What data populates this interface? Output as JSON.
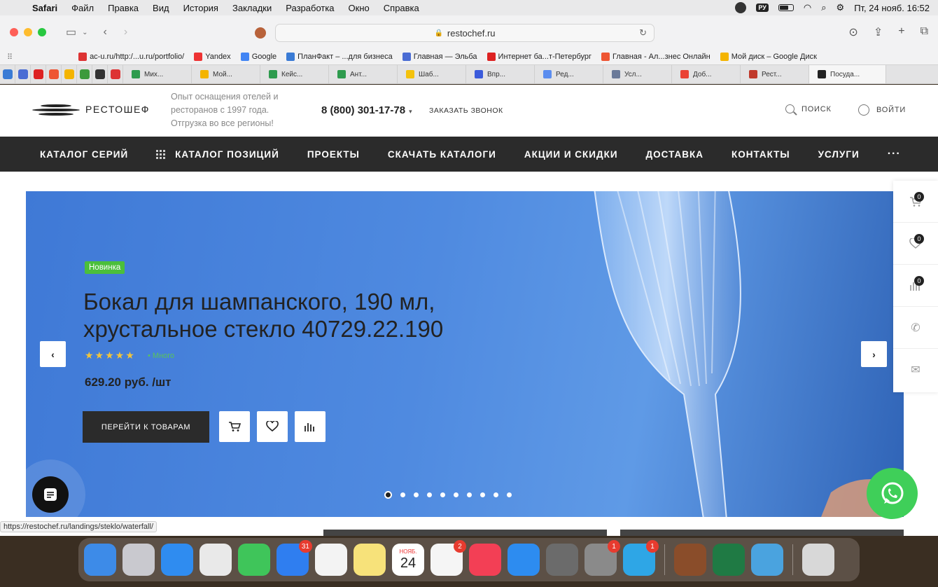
{
  "menubar": {
    "app": "Safari",
    "items": [
      "Файл",
      "Правка",
      "Вид",
      "История",
      "Закладки",
      "Разработка",
      "Окно",
      "Справка"
    ],
    "input_source": "РУ",
    "datetime": "Пт, 24 нояб.  16:52"
  },
  "browser": {
    "url": "restochef.ru",
    "status_url": "https://restochef.ru/landings/steklo/waterfall/",
    "bookmarks": [
      {
        "label": "ac-u.ru/http:/...u.ru/portfolio/",
        "color": "#d33"
      },
      {
        "label": "Yandex",
        "color": "#e33"
      },
      {
        "label": "Google",
        "color": "#4285f4"
      },
      {
        "label": "ПланФакт – ...для бизнеса",
        "color": "#3a7bd5"
      },
      {
        "label": "Главная — Эльба",
        "color": "#4a6cd4"
      },
      {
        "label": "Интернет ба...т-Петербург",
        "color": "#d22"
      },
      {
        "label": "Главная - Ал...знес Онлайн",
        "color": "#e53"
      },
      {
        "label": "Мой диск – Google Диск",
        "color": "#f4b400"
      }
    ],
    "pinned_tabs": [
      {
        "name": "pf",
        "color": "#3a7bd5"
      },
      {
        "name": "elba",
        "color": "#4a6cd4"
      },
      {
        "name": "bank",
        "color": "#d22"
      },
      {
        "name": "alfa",
        "color": "#e53"
      },
      {
        "name": "drive",
        "color": "#f4b400"
      },
      {
        "name": "green",
        "color": "#3c9a3c"
      },
      {
        "name": "g-black",
        "color": "#333"
      },
      {
        "name": "red-app",
        "color": "#d33"
      }
    ],
    "tabs": [
      {
        "label": "Мих...",
        "color": "#2e9b4e"
      },
      {
        "label": "Мой...",
        "color": "#f4b400"
      },
      {
        "label": "Кейс...",
        "color": "#2e9b4e"
      },
      {
        "label": "Ант...",
        "color": "#2e9b4e"
      },
      {
        "label": "Шаб...",
        "color": "#f4c20d"
      },
      {
        "label": "Впр...",
        "color": "#3b5bdb"
      },
      {
        "label": "Ред...",
        "color": "#5b8def"
      },
      {
        "label": "Усл...",
        "color": "#6b7a99"
      },
      {
        "label": "Доб...",
        "color": "#ea4335"
      },
      {
        "label": "Рест...",
        "color": "#c0392b"
      },
      {
        "label": "Посуда...",
        "color": "#222"
      }
    ]
  },
  "site": {
    "logo_text": "РЕСТОШЕФ",
    "tagline": "Опыт оснащения отелей и ресторанов с 1997 года. Отгрузка во все регионы!",
    "phone": "8 (800) 301-17-78",
    "callback": "ЗАКАЗАТЬ ЗВОНОК",
    "search": "ПОИСК",
    "login": "ВОЙТИ",
    "nav": [
      "КАТАЛОГ СЕРИЙ",
      "КАТАЛОГ ПОЗИЦИЙ",
      "ПРОЕКТЫ",
      "СКАЧАТЬ КАТАЛОГИ",
      "АКЦИИ И СКИДКИ",
      "ДОСТАВКА",
      "КОНТАКТЫ",
      "УСЛУГИ"
    ],
    "nav_more": "···",
    "banner": {
      "badge": "Новинка",
      "title": "Бокал для шампанского, 190 мл, хрустальное стекло 40729.22.190",
      "rating": 5,
      "stars": "★★★★★",
      "stock": "• Много",
      "price": "629.20 руб. /шт",
      "cta": "ПЕРЕЙТИ К ТОВАРАМ",
      "slides_total": 10,
      "active_slide": 1
    },
    "side_panel": {
      "cart_count": "0",
      "favorites_count": "0",
      "compare_count": "0"
    }
  },
  "dock": [
    {
      "name": "finder",
      "color": "#3d8be8"
    },
    {
      "name": "launchpad",
      "color": "#c9c9cf"
    },
    {
      "name": "safari",
      "color": "#2f8cf0"
    },
    {
      "name": "chrome",
      "color": "#e9e9e9"
    },
    {
      "name": "messages",
      "color": "#3fc55a"
    },
    {
      "name": "mail",
      "color": "#2f7ef0",
      "badge": "31"
    },
    {
      "name": "photos",
      "color": "#f3f3f3"
    },
    {
      "name": "notes",
      "color": "#f7e27a"
    },
    {
      "name": "calendar",
      "color": "#ffffff",
      "month": "НОЯБ.",
      "day": "24"
    },
    {
      "name": "reminders",
      "color": "#f5f5f5",
      "badge": "2"
    },
    {
      "name": "music",
      "color": "#f33f55"
    },
    {
      "name": "app-store",
      "color": "#2d8cf0"
    },
    {
      "name": "calculator",
      "color": "#6b6b6b"
    },
    {
      "name": "system-settings",
      "color": "#8a8a8a",
      "badge": "1"
    },
    {
      "name": "telegram",
      "color": "#2ea6e6",
      "badge": "1"
    },
    {
      "name": "sep"
    },
    {
      "name": "chess-app",
      "color": "#8a4d2a"
    },
    {
      "name": "excel",
      "color": "#1f7a44"
    },
    {
      "name": "shield-app",
      "color": "#4aa3df"
    },
    {
      "name": "sep"
    },
    {
      "name": "trash",
      "color": "#d8d8d8"
    }
  ],
  "colors": {
    "nav_bg": "#2b2b2b",
    "banner_blue": "#4f8ae0",
    "badge_green": "#4bbf3b",
    "whatsapp": "#3fcf59"
  }
}
